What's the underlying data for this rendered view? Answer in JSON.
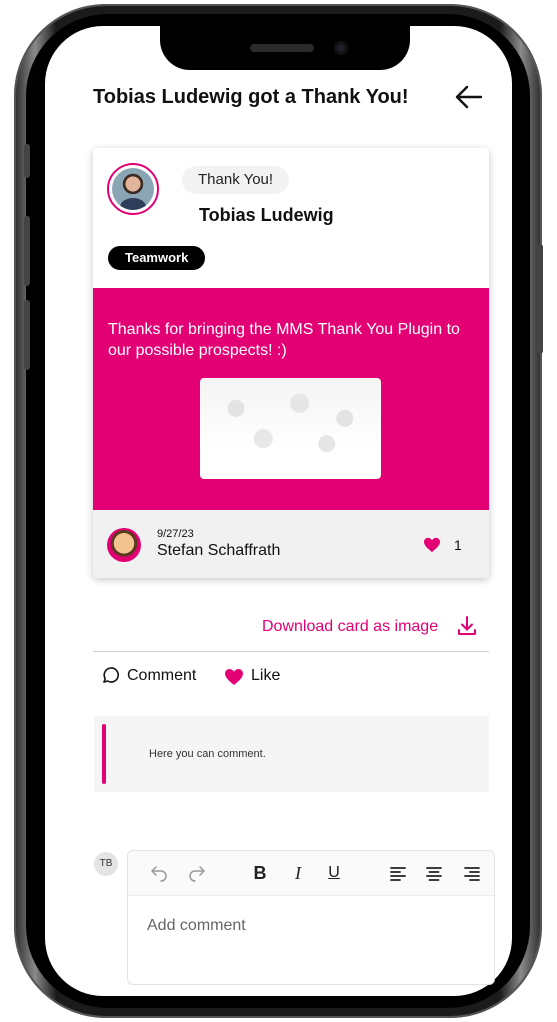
{
  "header": {
    "title": "Tobias Ludewig got a Thank You!",
    "back_icon": "arrow-left-icon"
  },
  "card": {
    "badge_label": "Thank You!",
    "recipient_name": "Tobias Ludewig",
    "tag": "Teamwork",
    "message": "Thanks for bringing the MMS Thank You Plugin to our possible prospects! :)",
    "date": "9/27/23",
    "sender_name": "Stefan Schaffrath",
    "like_count": "1"
  },
  "download": {
    "label": "Download card as image",
    "icon": "download-icon"
  },
  "actions": {
    "comment_label": "Comment",
    "like_label": "Like"
  },
  "comment_box": {
    "hint": "Here you can comment."
  },
  "editor": {
    "user_initials": "TB",
    "bold": "B",
    "italic": "I",
    "underline": "U",
    "placeholder": "Add comment"
  },
  "colors": {
    "accent": "#e20074",
    "tag_bg": "#000000",
    "footer_bg": "#f1f1f1"
  }
}
